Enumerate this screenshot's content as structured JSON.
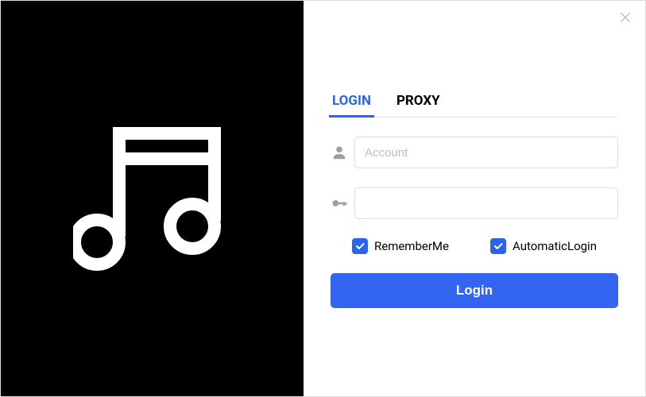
{
  "tabs": {
    "login": "LOGIN",
    "proxy": "PROXY"
  },
  "form": {
    "account_placeholder": "Account",
    "account_value": "",
    "password_placeholder": "",
    "password_value": ""
  },
  "checks": {
    "remember_label": "RememberMe",
    "remember_checked": true,
    "auto_label": "AutomaticLogin",
    "auto_checked": true
  },
  "buttons": {
    "login": "Login"
  }
}
